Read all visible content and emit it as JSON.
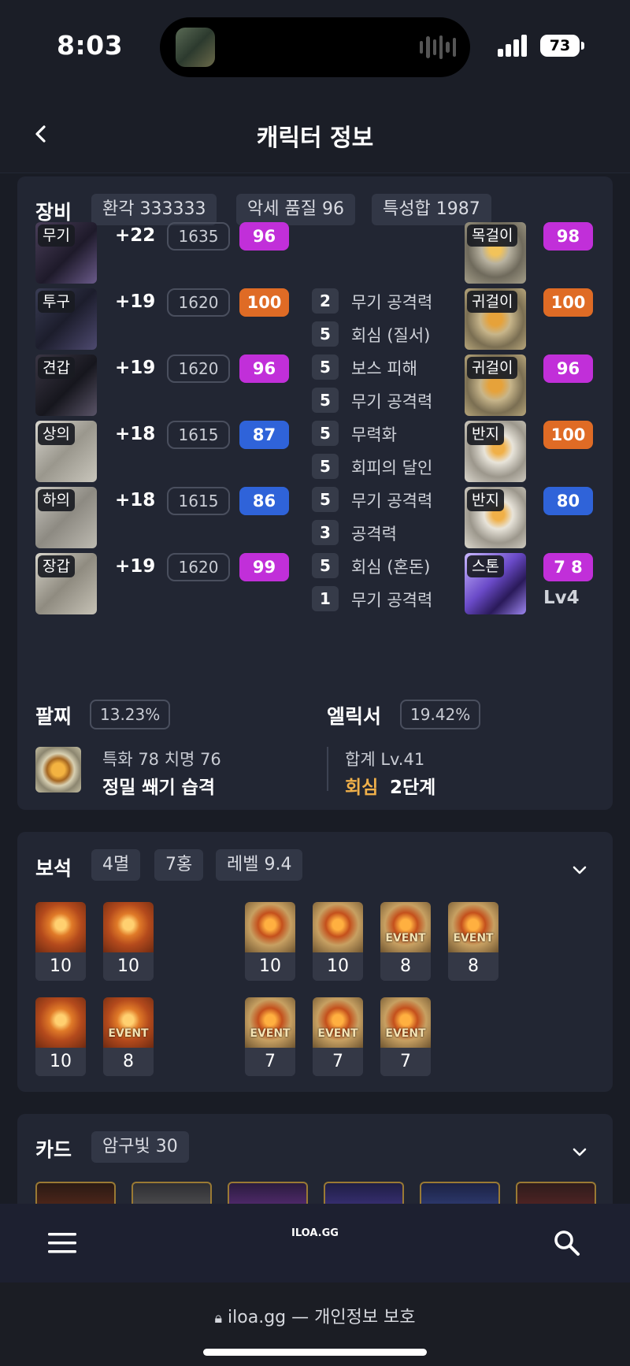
{
  "status_bar": {
    "time": "8:03",
    "battery": "73"
  },
  "header": {
    "title": "캐릭터 정보"
  },
  "equipment": {
    "title": "장비",
    "chips": [
      "환각 333333",
      "악세 품질 96",
      "특성합 1987"
    ],
    "items": [
      {
        "label": "무기",
        "enhance": "+22",
        "item_level": "1635",
        "quality": "96",
        "quality_color": "purple"
      },
      {
        "label": "투구",
        "enhance": "+19",
        "item_level": "1620",
        "quality": "100",
        "quality_color": "orange"
      },
      {
        "label": "견갑",
        "enhance": "+19",
        "item_level": "1620",
        "quality": "96",
        "quality_color": "purple"
      },
      {
        "label": "상의",
        "enhance": "+18",
        "item_level": "1615",
        "quality": "87",
        "quality_color": "blue"
      },
      {
        "label": "하의",
        "enhance": "+18",
        "item_level": "1615",
        "quality": "86",
        "quality_color": "blue"
      },
      {
        "label": "장갑",
        "enhance": "+19",
        "item_level": "1620",
        "quality": "99",
        "quality_color": "purple"
      }
    ],
    "engravings": [
      {
        "n": "2",
        "name": "무기 공격력"
      },
      {
        "n": "5",
        "name": "회심 (질서)"
      },
      {
        "n": "5",
        "name": "보스 피해"
      },
      {
        "n": "5",
        "name": "무기 공격력"
      },
      {
        "n": "5",
        "name": "무력화"
      },
      {
        "n": "5",
        "name": "회피의 달인"
      },
      {
        "n": "5",
        "name": "무기 공격력"
      },
      {
        "n": "3",
        "name": "공격력"
      },
      {
        "n": "5",
        "name": "회심 (혼돈)"
      },
      {
        "n": "1",
        "name": "무기 공격력"
      }
    ],
    "accessories": [
      {
        "label": "목걸이",
        "quality": "98",
        "quality_color": "purple"
      },
      {
        "label": "귀걸이",
        "quality": "100",
        "quality_color": "orange"
      },
      {
        "label": "귀걸이",
        "quality": "96",
        "quality_color": "purple"
      },
      {
        "label": "반지",
        "quality": "100",
        "quality_color": "orange"
      },
      {
        "label": "반지",
        "quality": "80",
        "quality_color": "blue"
      },
      {
        "label": "스톤",
        "quality": "7 8",
        "quality_color": "purple",
        "sub": "Lv4"
      }
    ]
  },
  "bracelet": {
    "title": "팔찌",
    "percent": "13.23%",
    "stats": "특화 78  치명 76",
    "effects": "정밀  쐐기  습격"
  },
  "elixir": {
    "title": "엘릭서",
    "percent": "19.42%",
    "total": "합계 Lv.41",
    "set_name": "회심",
    "set_level": "2단계"
  },
  "gems": {
    "title": "보석",
    "chips": [
      "4멸",
      "7홍",
      "레벨 9.4"
    ],
    "event_label": "EVENT",
    "row1": [
      {
        "level": "10",
        "kind": "멸",
        "event": false
      },
      {
        "level": "10",
        "kind": "멸",
        "event": false
      },
      {
        "level": "10",
        "kind": "홍",
        "event": false
      },
      {
        "level": "10",
        "kind": "홍",
        "event": false
      },
      {
        "level": "8",
        "kind": "홍",
        "event": true
      },
      {
        "level": "8",
        "kind": "홍",
        "event": true
      }
    ],
    "row2": [
      {
        "level": "10",
        "kind": "멸",
        "event": false
      },
      {
        "level": "8",
        "kind": "멸",
        "event": true
      },
      {
        "level": "7",
        "kind": "홍",
        "event": true
      },
      {
        "level": "7",
        "kind": "홍",
        "event": true
      },
      {
        "level": "7",
        "kind": "홍",
        "event": true
      }
    ]
  },
  "cards": {
    "title": "카드",
    "chip": "암구빛 30"
  },
  "bottom_bar": {
    "logo": "ILOA.GG"
  },
  "safari": {
    "url": "iloa.gg — 개인정보 보호"
  },
  "colors": {
    "purple": "#c12fd9",
    "orange": "#df6b25",
    "blue": "#2f63d9",
    "elixir_accent": "#f0b04a"
  }
}
